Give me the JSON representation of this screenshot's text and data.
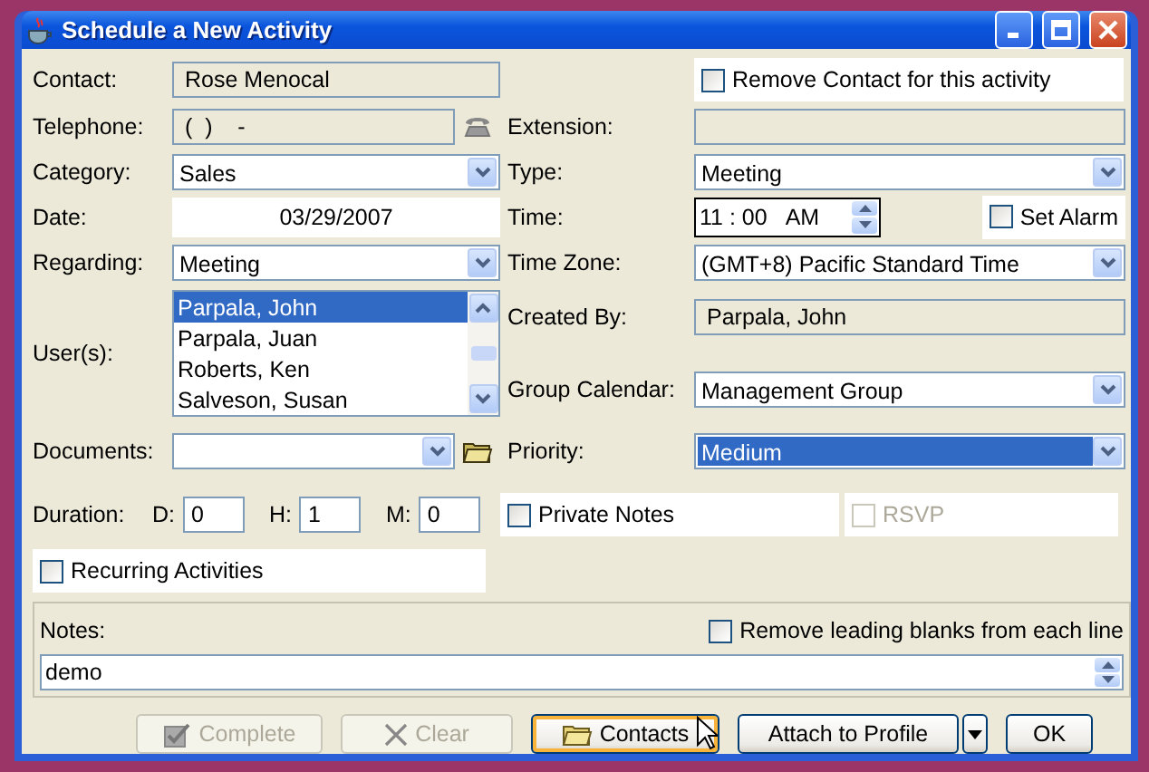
{
  "window": {
    "title": "Schedule a New Activity"
  },
  "contact": {
    "label": "Contact:",
    "value": "Rose Menocal"
  },
  "remove_contact": {
    "label": "Remove Contact for this activity",
    "checked": false
  },
  "telephone": {
    "label": "Telephone:",
    "value": "(  )    -"
  },
  "extension": {
    "label": "Extension:"
  },
  "category": {
    "label": "Category:",
    "value": "Sales"
  },
  "type": {
    "label": "Type:",
    "value": "Meeting"
  },
  "date": {
    "label": "Date:",
    "value": "03/29/2007"
  },
  "time": {
    "label": "Time:",
    "value": "11 : 00",
    "ampm": "AM"
  },
  "set_alarm": {
    "label": "Set Alarm",
    "checked": false
  },
  "regarding": {
    "label": "Regarding:",
    "value": "Meeting"
  },
  "time_zone": {
    "label": "Time Zone:",
    "value": "(GMT+8) Pacific Standard Time"
  },
  "users": {
    "label": "User(s):",
    "items": [
      {
        "name": "Parpala, John",
        "selected": true
      },
      {
        "name": "Parpala, Juan",
        "selected": false
      },
      {
        "name": "Roberts, Ken",
        "selected": false
      },
      {
        "name": "Salveson, Susan",
        "selected": false
      }
    ]
  },
  "created_by": {
    "label": "Created By:",
    "value": "Parpala, John"
  },
  "group_calendar": {
    "label": "Group Calendar:",
    "value": "Management Group"
  },
  "documents": {
    "label": "Documents:"
  },
  "priority": {
    "label": "Priority:",
    "value": "Medium",
    "focused": true
  },
  "duration": {
    "label": "Duration:",
    "fields": [
      {
        "label": "D:",
        "value": "0"
      },
      {
        "label": "H:",
        "value": "1"
      },
      {
        "label": "M:",
        "value": "0"
      }
    ]
  },
  "private_notes": {
    "label": "Private Notes",
    "checked": false
  },
  "rsvp": {
    "label": "RSVP",
    "checked": false,
    "disabled": true
  },
  "recurring": {
    "label": "Recurring Activities",
    "checked": false
  },
  "notes": {
    "label": "Notes:",
    "value": "demo"
  },
  "remove_blanks": {
    "label": "Remove leading blanks from each line",
    "checked": false
  },
  "buttons": [
    {
      "kind": "complete",
      "label": "Complete",
      "disabled": true,
      "default": false
    },
    {
      "kind": "clear",
      "label": "Clear",
      "disabled": true,
      "default": false
    },
    {
      "kind": "contacts",
      "label": "Contacts",
      "disabled": false,
      "default": true
    },
    {
      "kind": "attach",
      "label": "Attach to Profile",
      "disabled": false,
      "default": false
    },
    {
      "kind": "menu",
      "disabled": false,
      "default": false
    },
    {
      "kind": "ok",
      "label": "OK",
      "disabled": false,
      "default": false
    }
  ]
}
